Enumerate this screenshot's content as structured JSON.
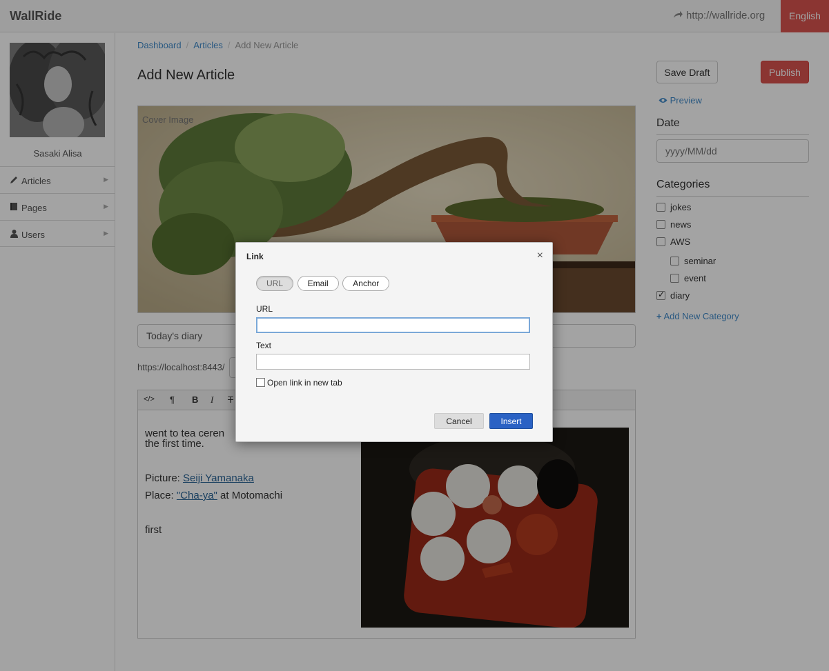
{
  "header": {
    "brand": "WallRide",
    "site_link": "http://wallride.org",
    "language": "English"
  },
  "sidebar": {
    "username": "Sasaki Alisa",
    "items": [
      {
        "label": "Articles",
        "icon": "pencil-icon"
      },
      {
        "label": "Pages",
        "icon": "book-icon"
      },
      {
        "label": "Users",
        "icon": "user-icon"
      }
    ]
  },
  "breadcrumb": [
    "Dashboard",
    "Articles",
    "Add New Article"
  ],
  "main": {
    "title": "Add New Article",
    "cover_label": "Cover Image",
    "article_title": "Today's diary",
    "url_prefix": "https://localhost:8443/",
    "editor": {
      "toolbar": [
        "</>",
        "¶",
        "B",
        "I",
        "T"
      ],
      "line1": "went to tea ceren",
      "line2": "the first time.",
      "picture_label": "Picture: ",
      "picture_link": "Seiji Yamanaka",
      "place_label": "Place: ",
      "place_link": "\"Cha-ya\"",
      "place_suffix": " at Motomachi",
      "footer_word": "first"
    }
  },
  "right_panel": {
    "save_draft": "Save Draft",
    "publish": "Publish",
    "preview": "Preview",
    "date_heading": "Date",
    "date_placeholder": "yyyy/MM/dd",
    "categories_heading": "Categories",
    "categories": [
      {
        "label": "jokes",
        "checked": false
      },
      {
        "label": "news",
        "checked": false
      },
      {
        "label": "AWS",
        "checked": false
      },
      {
        "label": "seminar",
        "checked": false
      },
      {
        "label": "event",
        "checked": false
      },
      {
        "label": "diary",
        "checked": true
      }
    ],
    "add_category": "Add New Category"
  },
  "dialog": {
    "title": "Link",
    "close": "×",
    "tabs": [
      "URL",
      "Email",
      "Anchor"
    ],
    "url_label": "URL",
    "url_value": "",
    "text_label": "Text",
    "text_value": "",
    "new_tab_label": "Open link in new tab",
    "cancel": "Cancel",
    "insert": "Insert"
  },
  "colors": {
    "accent_red": "#d9534f",
    "link_blue": "#428bca",
    "insert_blue": "#2a62c4"
  }
}
